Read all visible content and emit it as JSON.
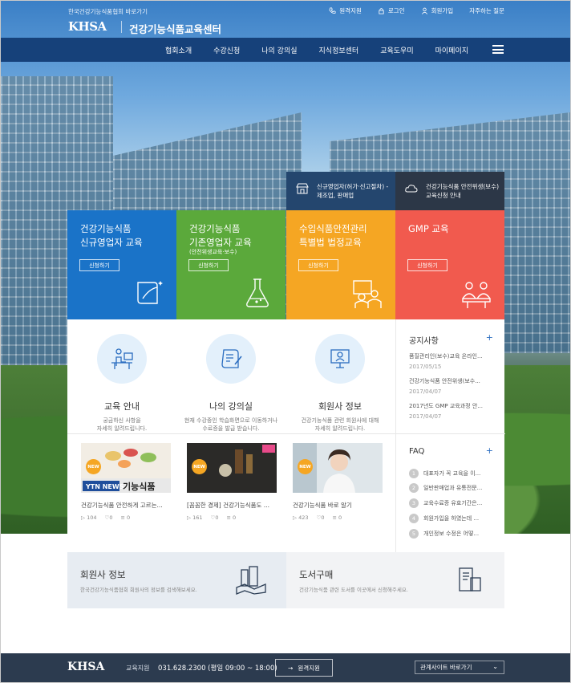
{
  "topbar": {
    "org_link": "한국건강기능식품협회 바로가기",
    "util": [
      {
        "icon": "phone-icon",
        "label": "원격지원"
      },
      {
        "icon": "lock-icon",
        "label": "로그인"
      },
      {
        "icon": "person-icon",
        "label": "회원가입"
      },
      {
        "icon": "",
        "label": "자주하는 질문"
      }
    ],
    "logo": "KHSA",
    "site_name": "건강기능식품교육센터"
  },
  "nav": {
    "items": [
      "협회소개",
      "수강신청",
      "나의 강의실",
      "지식정보센터",
      "교육도우미",
      "마이페이지"
    ]
  },
  "notices_top": [
    {
      "icon": "store-icon",
      "text": "신규영업자(허가·신고절차) -제조업, 판매업"
    },
    {
      "icon": "cloud-icon",
      "text": "건강기능식품 안전위생(보수)교육신청 안내"
    }
  ],
  "tiles": [
    {
      "title_1": "건강기능식품",
      "title_2": "신규영업자 교육",
      "sub": "",
      "button": "신청하기",
      "color": "#1a73c8"
    },
    {
      "title_1": "건강기능식품",
      "title_2": "기존영업자 교육",
      "sub": "(안전위생교육·보수)",
      "button": "신청하기",
      "color": "#5ba93b"
    },
    {
      "title_1": "수입식품안전관리",
      "title_2": "특별법 법정교육",
      "sub": "",
      "button": "신청하기",
      "color": "#f5a623"
    },
    {
      "title_1": "GMP 교육",
      "title_2": "",
      "sub": "",
      "button": "신청하기",
      "color": "#f15a4e"
    }
  ],
  "features": [
    {
      "title": "교육 안내",
      "desc_1": "궁금하신 사항을",
      "desc_2": "자세히 알려드립니다."
    },
    {
      "title": "나의 강의실",
      "desc_1": "현재 수강중인 학습화면으로 이동하거나",
      "desc_2": "수료증을 발급 받습니다."
    },
    {
      "title": "회원사 정보",
      "desc_1": "건강기능식품 관련 회원사에 대해",
      "desc_2": "자세히 알려드립니다."
    }
  ],
  "videos": [
    {
      "badge": "NEW",
      "title": "건강기능식품 안전하게 고르는...",
      "plays": "104",
      "likes": "0",
      "comments": "0"
    },
    {
      "badge": "NEW",
      "title": "[꼼꼼한 경제] 건강기능식품도 ...",
      "plays": "161",
      "likes": "0",
      "comments": "0"
    },
    {
      "badge": "NEW",
      "title": "건강기능식품 바로 알기",
      "plays": "423",
      "likes": "0",
      "comments": "0"
    }
  ],
  "notice": {
    "title": "공지사항",
    "items": [
      {
        "text": "품질관리인(보수)교육 온라인...",
        "date": "2017/05/15"
      },
      {
        "text": "건강기능식품 안전위생(보수...",
        "date": "2017/04/07"
      },
      {
        "text": "2017년도 GMP 교육과정 안...",
        "date": "2017/04/07"
      }
    ]
  },
  "faq": {
    "title": "FAQ",
    "items": [
      {
        "num": "1",
        "text": "대표자가 꼭 교육을 이..."
      },
      {
        "num": "2",
        "text": "일반판매업과 유통전문..."
      },
      {
        "num": "3",
        "text": "교육수료증 유효기간은..."
      },
      {
        "num": "4",
        "text": "회원가입을 하였는데 ..."
      },
      {
        "num": "5",
        "text": "개인정보 수정은 어떻..."
      }
    ]
  },
  "banners": [
    {
      "title": "회원사 정보",
      "desc": "한국건강기능식품협회 회원사의 정보를 검색해보세요."
    },
    {
      "title": "도서구매",
      "desc": "건강기능식품 관련 도서를 이곳에서 신청해주세요."
    }
  ],
  "footer": {
    "logo": "KHSA",
    "label": "교육지원",
    "phone": "031.628.2300 (평일 09:00 ~ 18:00)",
    "remote_button": "원격지원",
    "related_sites": "관계사이트 바로가기"
  },
  "colors": {
    "nav": "#16417a",
    "footer": "#2c3b4f",
    "accent": "#2a6dc0"
  }
}
